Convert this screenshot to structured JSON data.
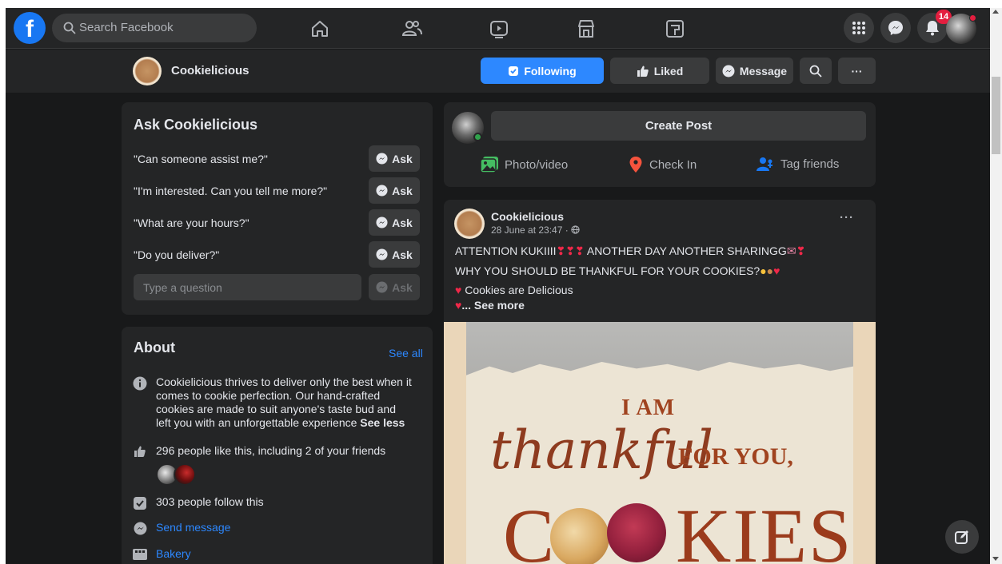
{
  "search": {
    "placeholder": "Search Facebook"
  },
  "notifications": {
    "count": "14"
  },
  "page": {
    "name": "Cookielicious",
    "buttons": {
      "following": "Following",
      "liked": "Liked",
      "message": "Message",
      "more": "···"
    }
  },
  "ask": {
    "title": "Ask Cookielicious",
    "questions": [
      "\"Can someone assist me?\"",
      "\"I'm interested. Can you tell me more?\"",
      "\"What are your hours?\"",
      "\"Do you deliver?\""
    ],
    "ask_label": "Ask",
    "input_placeholder": "Type a question"
  },
  "about": {
    "title": "About",
    "see_all": "See all",
    "description": "Cookielicious thrives to deliver only the best when it comes to cookie perfection. Our hand-crafted cookies are made to suit anyone's taste bud and left you with an unforgettable experience",
    "see_less": "See less",
    "likes": "296 people like this, including 2 of your friends",
    "follows": "303 people follow this",
    "send_message": "Send message",
    "category": "Bakery"
  },
  "create_post": {
    "button": "Create Post",
    "actions": {
      "photo": "Photo/video",
      "checkin": "Check In",
      "tag": "Tag friends"
    }
  },
  "post": {
    "author": "Cookielicious",
    "time": "28 June at 23:47 · ",
    "line1": "ATTENTION KUKIIII",
    "line1b": "ANOTHER DAY ANOTHER SHARINGG",
    "line2": "WHY YOU SHOULD BE THANKFUL FOR YOUR COOKIES?",
    "line3": "Cookies are Delicious",
    "see_more": "... See more",
    "image_text": {
      "line1": "I AM",
      "line2": "thankful",
      "line3": "FOR YOU,",
      "line4a": "C",
      "line4b": "KIES"
    }
  },
  "colors": {
    "accent": "#2d88ff",
    "background": "#18191a",
    "card": "#242526",
    "badge": "#e41e3f"
  }
}
